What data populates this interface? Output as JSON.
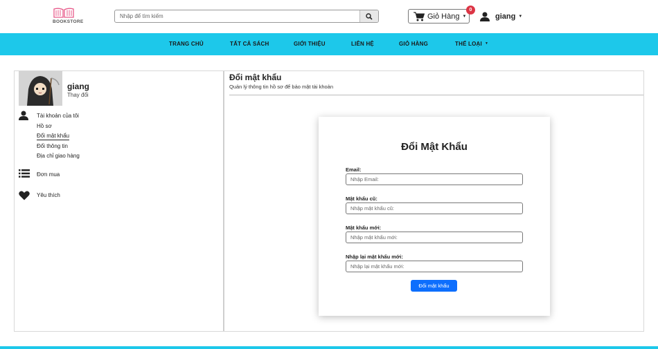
{
  "brand": {
    "logo_text": "BOOKSTORE",
    "accent": "#1dc8ea",
    "logo_color": "#e85a8a"
  },
  "search": {
    "placeholder": "Nhập để tìm kiếm",
    "icon": "search-icon"
  },
  "cart": {
    "label": "Giỏ Hàng",
    "count": "0",
    "icon": "cart-icon"
  },
  "user": {
    "name": "giang",
    "icon": "user-icon"
  },
  "nav": {
    "items": [
      "TRANG CHỦ",
      "TẤT CẢ SÁCH",
      "GIỚI THIỆU",
      "LIÊN HỆ",
      "GIỎ HÀNG",
      "THỂ LOẠI"
    ]
  },
  "sidebar": {
    "username": "giang",
    "change": "Thay đổi",
    "account": "Tài khoản của tôi",
    "sub": [
      "Hồ sơ",
      "Đổi mật khẩu",
      "Đổi thông tin",
      "Địa chỉ giao hàng"
    ],
    "orders": "Đơn mua",
    "favorites": "Yêu thích"
  },
  "page": {
    "title": "Đổi mật khẩu",
    "subtitle": "Quản lý thông tin hồ sơ để bảo mật tài khoản"
  },
  "form": {
    "heading": "Đổi Mật Khẩu",
    "email_label": "Email:",
    "email_placeholder": "Nhập Email:",
    "old_label": "Mật khẩu cũ:",
    "old_placeholder": "Nhập mật khẩu cũ:",
    "new_label": "Mật khẩu mới:",
    "new_placeholder": "Nhập mật khẩu mới:",
    "confirm_label": "Nhập lại mật khẩu mới:",
    "confirm_placeholder": "Nhập lại mật khẩu mới:",
    "submit": "Đổi mật khẩu",
    "button_color": "#0d6efd"
  }
}
